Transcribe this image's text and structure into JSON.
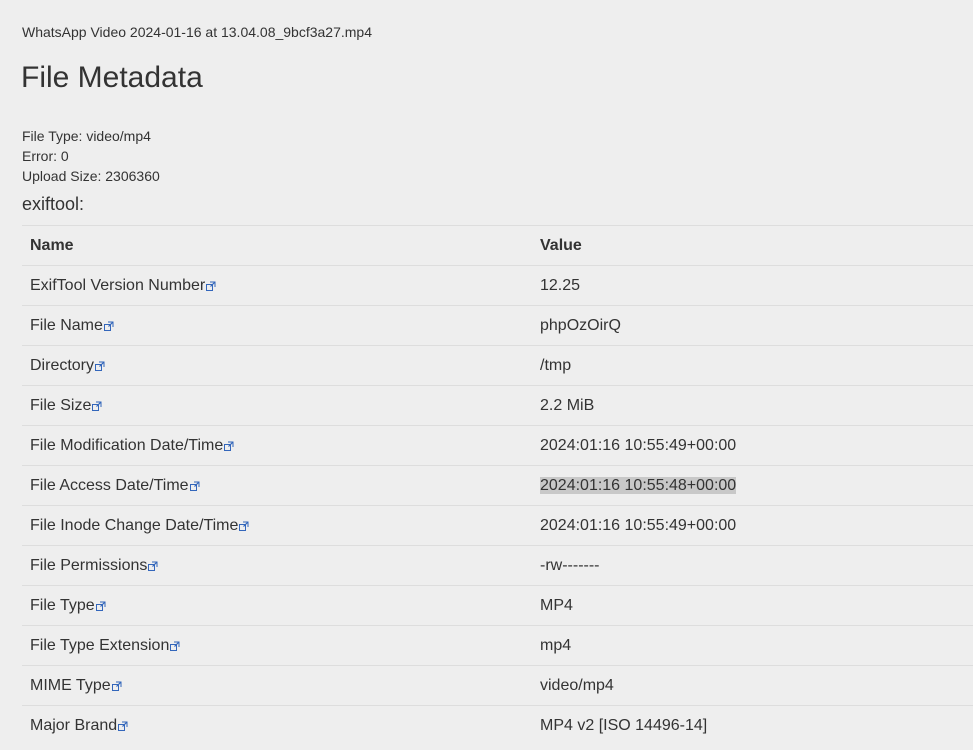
{
  "file_title": "WhatsApp Video 2024-01-16 at 13.04.08_9bcf3a27.mp4",
  "page_title": "File Metadata",
  "info": {
    "file_type": "File Type: video/mp4",
    "error": "Error: 0",
    "upload_size": "Upload Size: 2306360"
  },
  "section_label": "exiftool:",
  "table": {
    "headers": {
      "name": "Name",
      "value": "Value"
    },
    "rows": [
      {
        "name": "ExifTool Version Number",
        "value": "12.25"
      },
      {
        "name": "File Name",
        "value": "phpOzOirQ"
      },
      {
        "name": "Directory",
        "value": "/tmp"
      },
      {
        "name": "File Size",
        "value": "2.2 MiB"
      },
      {
        "name": "File Modification Date/Time",
        "value": "2024:01:16 10:55:49+00:00"
      },
      {
        "name": "File Access Date/Time",
        "value": "2024:01:16 10:55:48+00:00",
        "highlighted": true
      },
      {
        "name": "File Inode Change Date/Time",
        "value": "2024:01:16 10:55:49+00:00"
      },
      {
        "name": "File Permissions",
        "value": "-rw-------"
      },
      {
        "name": "File Type",
        "value": "MP4"
      },
      {
        "name": "File Type Extension",
        "value": "mp4"
      },
      {
        "name": "MIME Type",
        "value": "video/mp4"
      },
      {
        "name": "Major Brand",
        "value": "MP4 v2 [ISO 14496-14]"
      }
    ]
  },
  "icons": {
    "external_link": "external-link-icon"
  },
  "colors": {
    "background": "#eeeeee",
    "text": "#333333",
    "icon": "#3366bb",
    "highlight": "#c8c8c8",
    "border": "#dddddd"
  }
}
